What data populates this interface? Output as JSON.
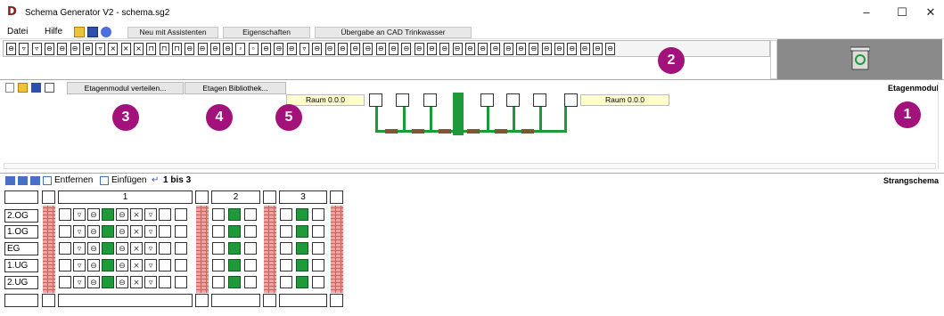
{
  "window": {
    "title": "Schema Generator V2  -  schema.sg2",
    "logo": "D"
  },
  "menu": [
    "Datei",
    "Hilfe"
  ],
  "toolbar": {
    "assistant": "Neu mit Assistenten",
    "properties": "Eigenschaften",
    "cad": "Übergabe an CAD Trinkwasser"
  },
  "floor_panel": {
    "distribute": "Etagenmodul verteilen...",
    "library": "Etagen Bibliothek...",
    "title": "Etagenmodul",
    "room_left": "Raum 0.0.0",
    "room_right": "Raum 0.0.0"
  },
  "strang": {
    "remove": "Entfernen",
    "insert": "Einfügen",
    "range": "1 bis 3",
    "title": "Strangschema",
    "columns": [
      "1",
      "2",
      "3"
    ],
    "floors": [
      "2.OG",
      "1.OG",
      "EG",
      "1.UG",
      "2.UG"
    ]
  },
  "badges": [
    "1",
    "2",
    "3",
    "4",
    "5"
  ],
  "colors": {
    "pipe": "#1e9a3a",
    "badge": "#a3127a",
    "brick": "#f2a0a0"
  }
}
